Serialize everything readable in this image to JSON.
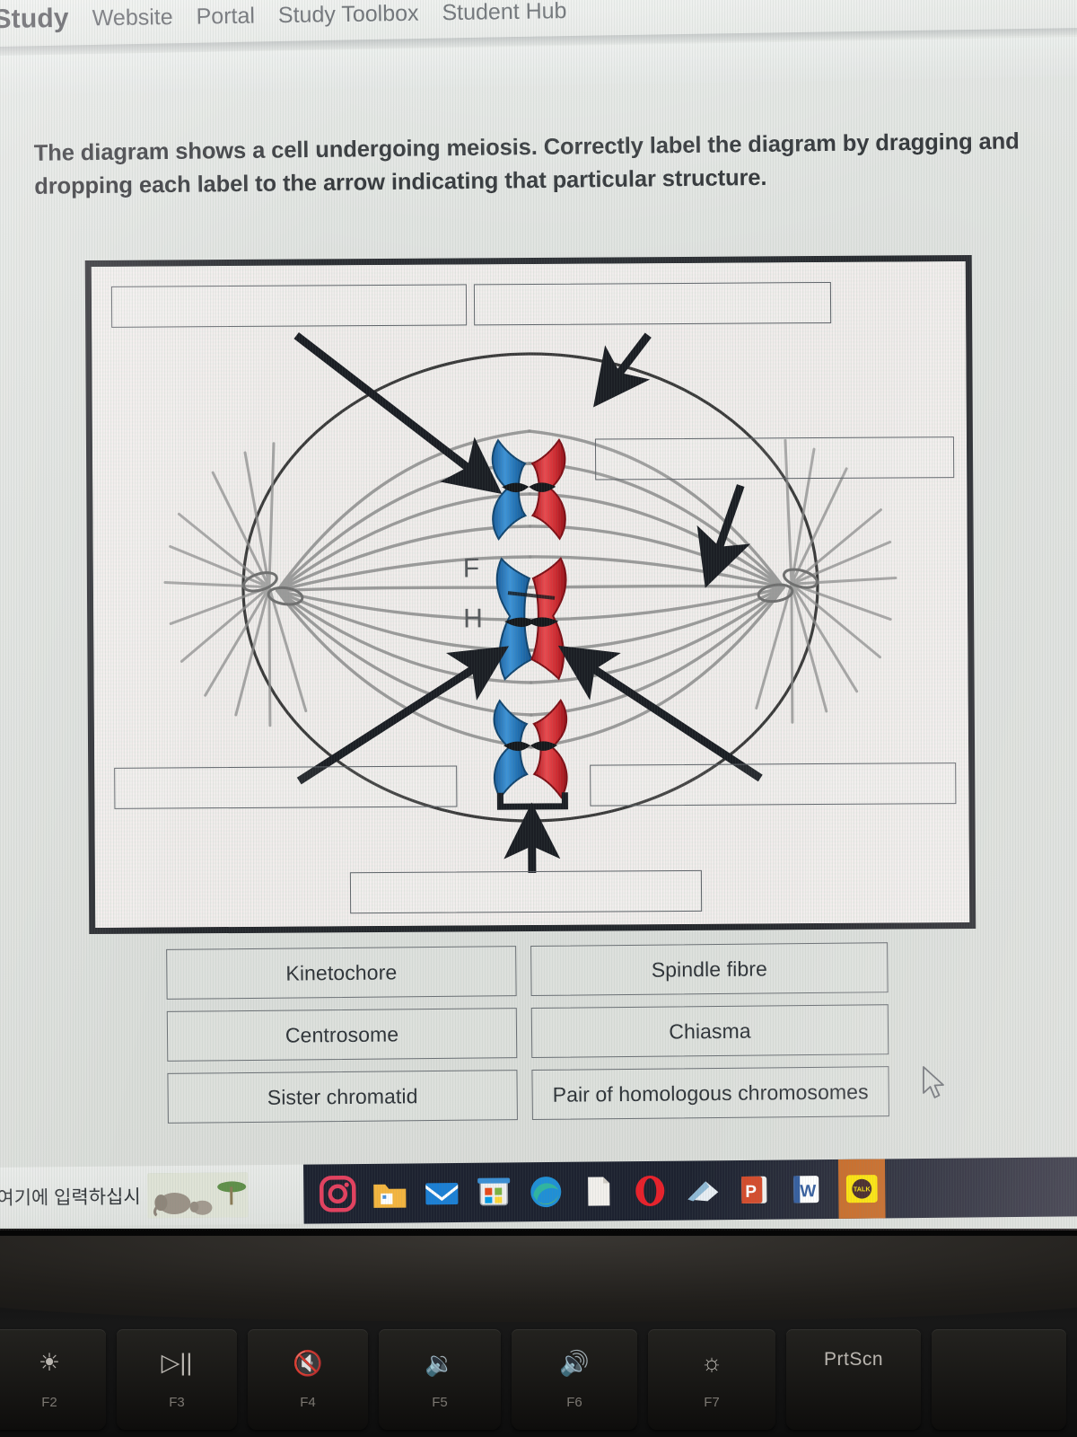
{
  "browser": {
    "nav": {
      "brand": "Study",
      "links": [
        "Website",
        "Portal",
        "Study Toolbox",
        "Student Hub"
      ]
    }
  },
  "question": {
    "prompt": "The diagram shows a cell undergoing meiosis. Correctly label the diagram by dragging and dropping each label to the arrow indicating that particular structure."
  },
  "diagram": {
    "title": "meiosis-metaphase-i-cell",
    "drop_targets": [
      {
        "id": "top-left",
        "value": ""
      },
      {
        "id": "top-right",
        "value": ""
      },
      {
        "id": "middle-right",
        "value": ""
      },
      {
        "id": "bottom-left",
        "value": ""
      },
      {
        "id": "bottom-right",
        "value": ""
      },
      {
        "id": "bottom-center",
        "value": ""
      }
    ],
    "annotations": {
      "letters": [
        "F",
        "H"
      ]
    },
    "colors": {
      "chromosome_blue": "#2f7fc4",
      "chromosome_red": "#d5353b",
      "spindle_grey": "#8c8c8c",
      "membrane": "#3a3a3a",
      "arrow": "#1b1e24",
      "frame_border": "#24272c"
    }
  },
  "answer_bank": {
    "options": [
      "Kinetochore",
      "Spindle fibre",
      "Centrosome",
      "Chiasma",
      "Sister chromatid",
      "Pair of homologous chromosomes"
    ]
  },
  "taskbar": {
    "search_placeholder": "여기에 입력하십시",
    "icons": [
      "instagram-icon",
      "file-explorer-icon",
      "mail-icon",
      "microsoft-store-icon",
      "edge-icon",
      "document-icon",
      "opera-icon",
      "onedrive-icon",
      "powerpoint-icon",
      "word-icon",
      "kakaotalk-icon"
    ],
    "kakaotalk_label": "TALK"
  },
  "keyboard": {
    "keys": [
      {
        "glyph": "☀",
        "fn": "F2"
      },
      {
        "glyph": "▷||",
        "fn": "F3"
      },
      {
        "glyph": "🔇",
        "fn": "F4"
      },
      {
        "glyph": "🔉",
        "fn": "F5"
      },
      {
        "glyph": "🔊",
        "fn": "F6"
      },
      {
        "glyph": "☼",
        "fn": "F7"
      },
      {
        "glyph": "PrtScn",
        "fn": ""
      }
    ]
  }
}
